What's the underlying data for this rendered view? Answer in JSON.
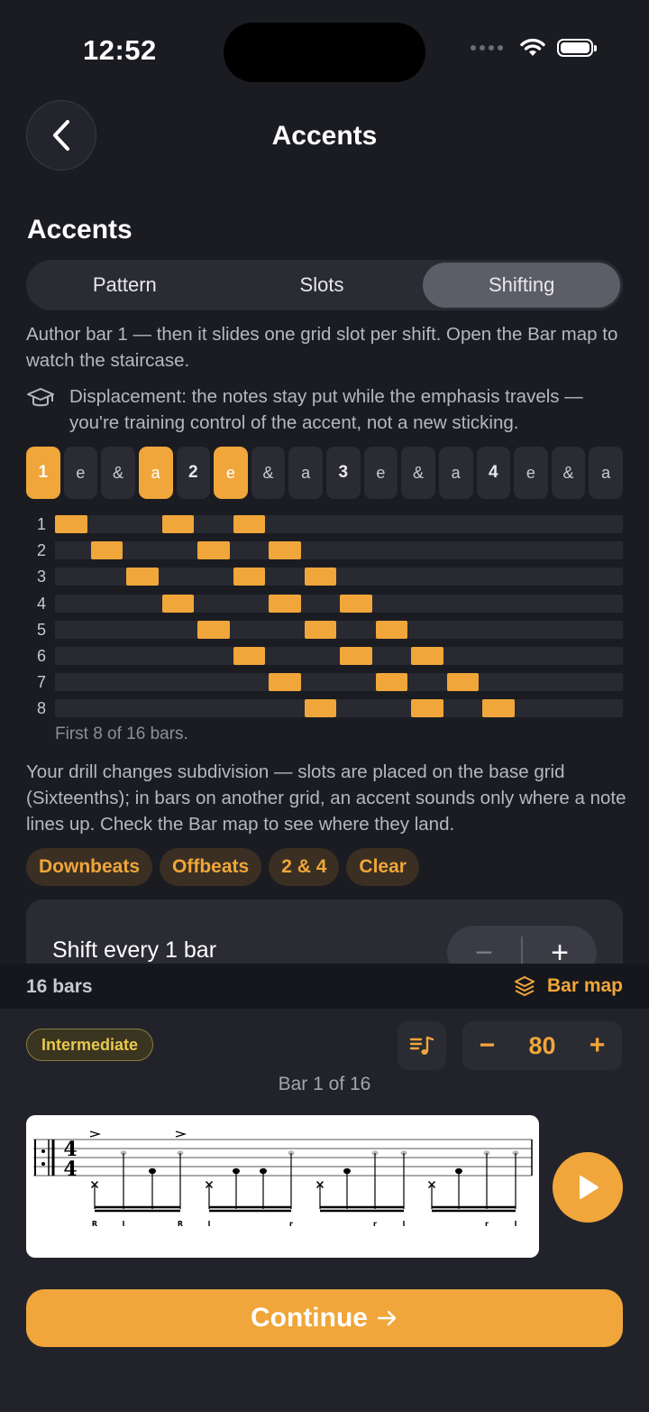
{
  "status": {
    "time": "12:52"
  },
  "nav": {
    "title": "Accents",
    "back_icon": "chevron-left-icon"
  },
  "section_title": "Accents",
  "tabs": [
    {
      "label": "Pattern",
      "active": false
    },
    {
      "label": "Slots",
      "active": false
    },
    {
      "label": "Shifting",
      "active": true
    }
  ],
  "description": "Author bar 1 — then it slides one grid slot per shift. Open the Bar map to watch the staircase.",
  "tip": {
    "icon": "graduation-cap-icon",
    "text": "Displacement: the notes stay put while the emphasis travels — you're training control of the accent, not a new sticking."
  },
  "slot_labels": [
    "1",
    "e",
    "&",
    "a",
    "2",
    "e",
    "&",
    "a",
    "3",
    "e",
    "&",
    "a",
    "4",
    "e",
    "&",
    "a"
  ],
  "slot_active": [
    0,
    3,
    5
  ],
  "staircase": {
    "bars": [
      {
        "label": "1",
        "cells": [
          0,
          3,
          5
        ]
      },
      {
        "label": "2",
        "cells": [
          1,
          4,
          6
        ]
      },
      {
        "label": "3",
        "cells": [
          2,
          5,
          7
        ]
      },
      {
        "label": "4",
        "cells": [
          3,
          6,
          8
        ]
      },
      {
        "label": "5",
        "cells": [
          4,
          7,
          9
        ]
      },
      {
        "label": "6",
        "cells": [
          5,
          8,
          10
        ]
      },
      {
        "label": "7",
        "cells": [
          6,
          9,
          11
        ]
      },
      {
        "label": "8",
        "cells": [
          7,
          10,
          12
        ]
      }
    ],
    "note": "First 8 of 16 bars."
  },
  "warning": "Your drill changes subdivision — slots are placed on the base grid (Sixteenths); in bars on another grid, an accent sounds only where a note lines up. Check the Bar map to see where they land.",
  "presets": [
    "Downbeats",
    "Offbeats",
    "2 & 4",
    "Clear"
  ],
  "shift": {
    "label": "Shift every 1 bar",
    "minus": "−",
    "plus": "+"
  },
  "footer": {
    "bars_label": "16 bars",
    "bar_map_label": "Bar map",
    "bar_map_icon": "layers-icon"
  },
  "player": {
    "level": "Intermediate",
    "list_icon": "music-list-icon",
    "tempo": {
      "minus": "−",
      "value": "80",
      "plus": "+"
    },
    "bar_position": "Bar 1 of 16",
    "time_signature": {
      "top": "4",
      "bottom": "4"
    },
    "stickings": [
      "R",
      "l",
      "R",
      "l",
      "r",
      "r",
      "l",
      "r",
      "l"
    ],
    "play_icon": "play-icon",
    "continue_label": "Continue",
    "continue_icon": "arrow-right-icon"
  },
  "colors": {
    "accent": "#f0a63a",
    "background": "#1b1c22",
    "card": "#2a2b33",
    "badge": "#e9c74d"
  }
}
